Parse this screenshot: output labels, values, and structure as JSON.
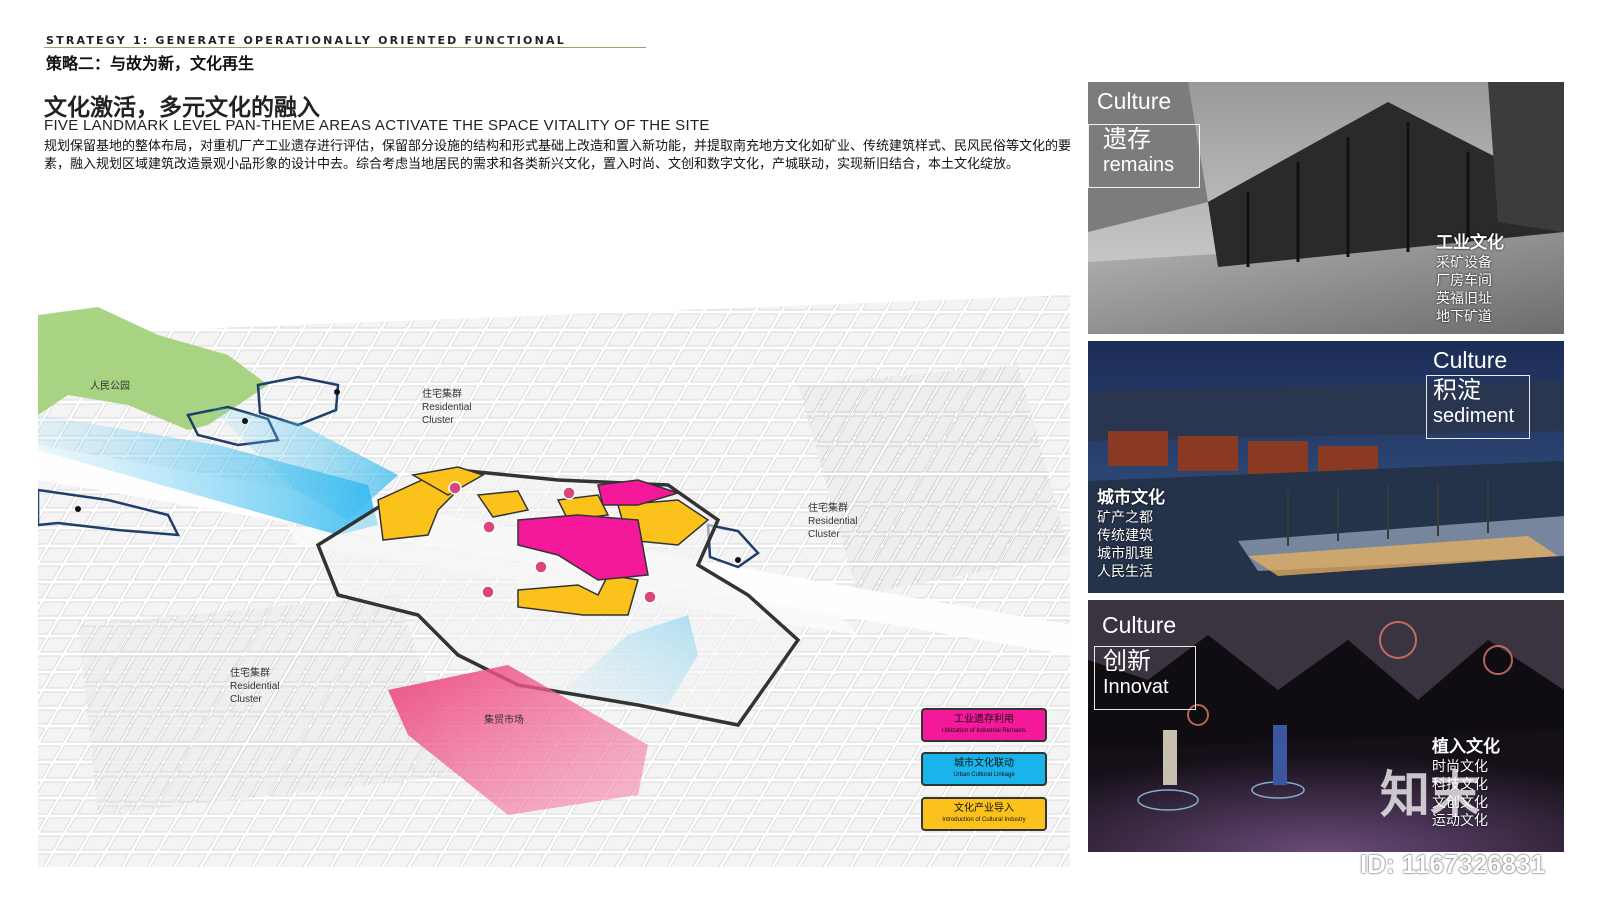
{
  "header": {
    "strategy": "STRATEGY 1: GENERATE OPERATIONALLY ORIENTED FUNCTIONAL",
    "subtitle": "策略二：与故为新，文化再生"
  },
  "title": {
    "cn": "文化激活，多元文化的融入",
    "en": "FIVE LANDMARK LEVEL PAN-THEME AREAS ACTIVATE THE SPACE VITALITY OF THE SITE"
  },
  "body_text": "规划保留基地的整体布局，对重机厂产工业遗存进行评估，保留部分设施的结构和形式基础上改造和置入新功能，并提取南充地方文化如矿业、传统建筑样式、民风民俗等文化的要素，融入规划区域建筑改造景观小品形象的设计中去。综合考虑当地居民的需求和各类新兴文化，置入时尚、文创和数字文化，产城联动，实现新旧结合，本土文化绽放。",
  "map": {
    "labels": {
      "park": "人民公园",
      "res1_cn": "住宅集群",
      "res1_en1": "Residential",
      "res1_en2": "Cluster",
      "res2_cn": "住宅集群",
      "res2_en1": "Residential",
      "res2_en2": "Cluster",
      "res3_cn": "住宅集群",
      "res3_en1": "Residential",
      "res3_en2": "Cluster",
      "market": "集贸市场"
    },
    "legend": [
      {
        "cn": "工业遗存利用",
        "en": "Utilization of Industrial Remains",
        "color": "#f4189a"
      },
      {
        "cn": "城市文化联动",
        "en": "Urban Cultural Linkage",
        "color": "#1ab3ea"
      },
      {
        "cn": "文化产业导入",
        "en": "Introduction of Cultural Industry",
        "color": "#fbc21c"
      }
    ]
  },
  "panels": [
    {
      "culture": "Culture",
      "box_cn": "遗存",
      "box_en": "remains",
      "heading": "工业文化",
      "items": [
        "采矿设备",
        "厂房车间",
        "英福旧址",
        "地下矿道"
      ],
      "stripe_color": "#f4189a"
    },
    {
      "culture": "Culture",
      "box_cn": "积淀",
      "box_en": "sediment",
      "heading": "城市文化",
      "items": [
        "矿产之都",
        "传统建筑",
        "城市肌理",
        "人民生活"
      ],
      "stripe_color": "#1ab3ea"
    },
    {
      "culture": "Culture",
      "box_cn": "创新",
      "box_en": "Innovat",
      "heading": "植入文化",
      "items": [
        "时尚文化",
        "科技文化",
        "文创文化",
        "运动文化"
      ],
      "stripe_color": "#fbc21c"
    }
  ],
  "watermark": {
    "logo_text": "知末",
    "id": "ID: 1167326831"
  }
}
